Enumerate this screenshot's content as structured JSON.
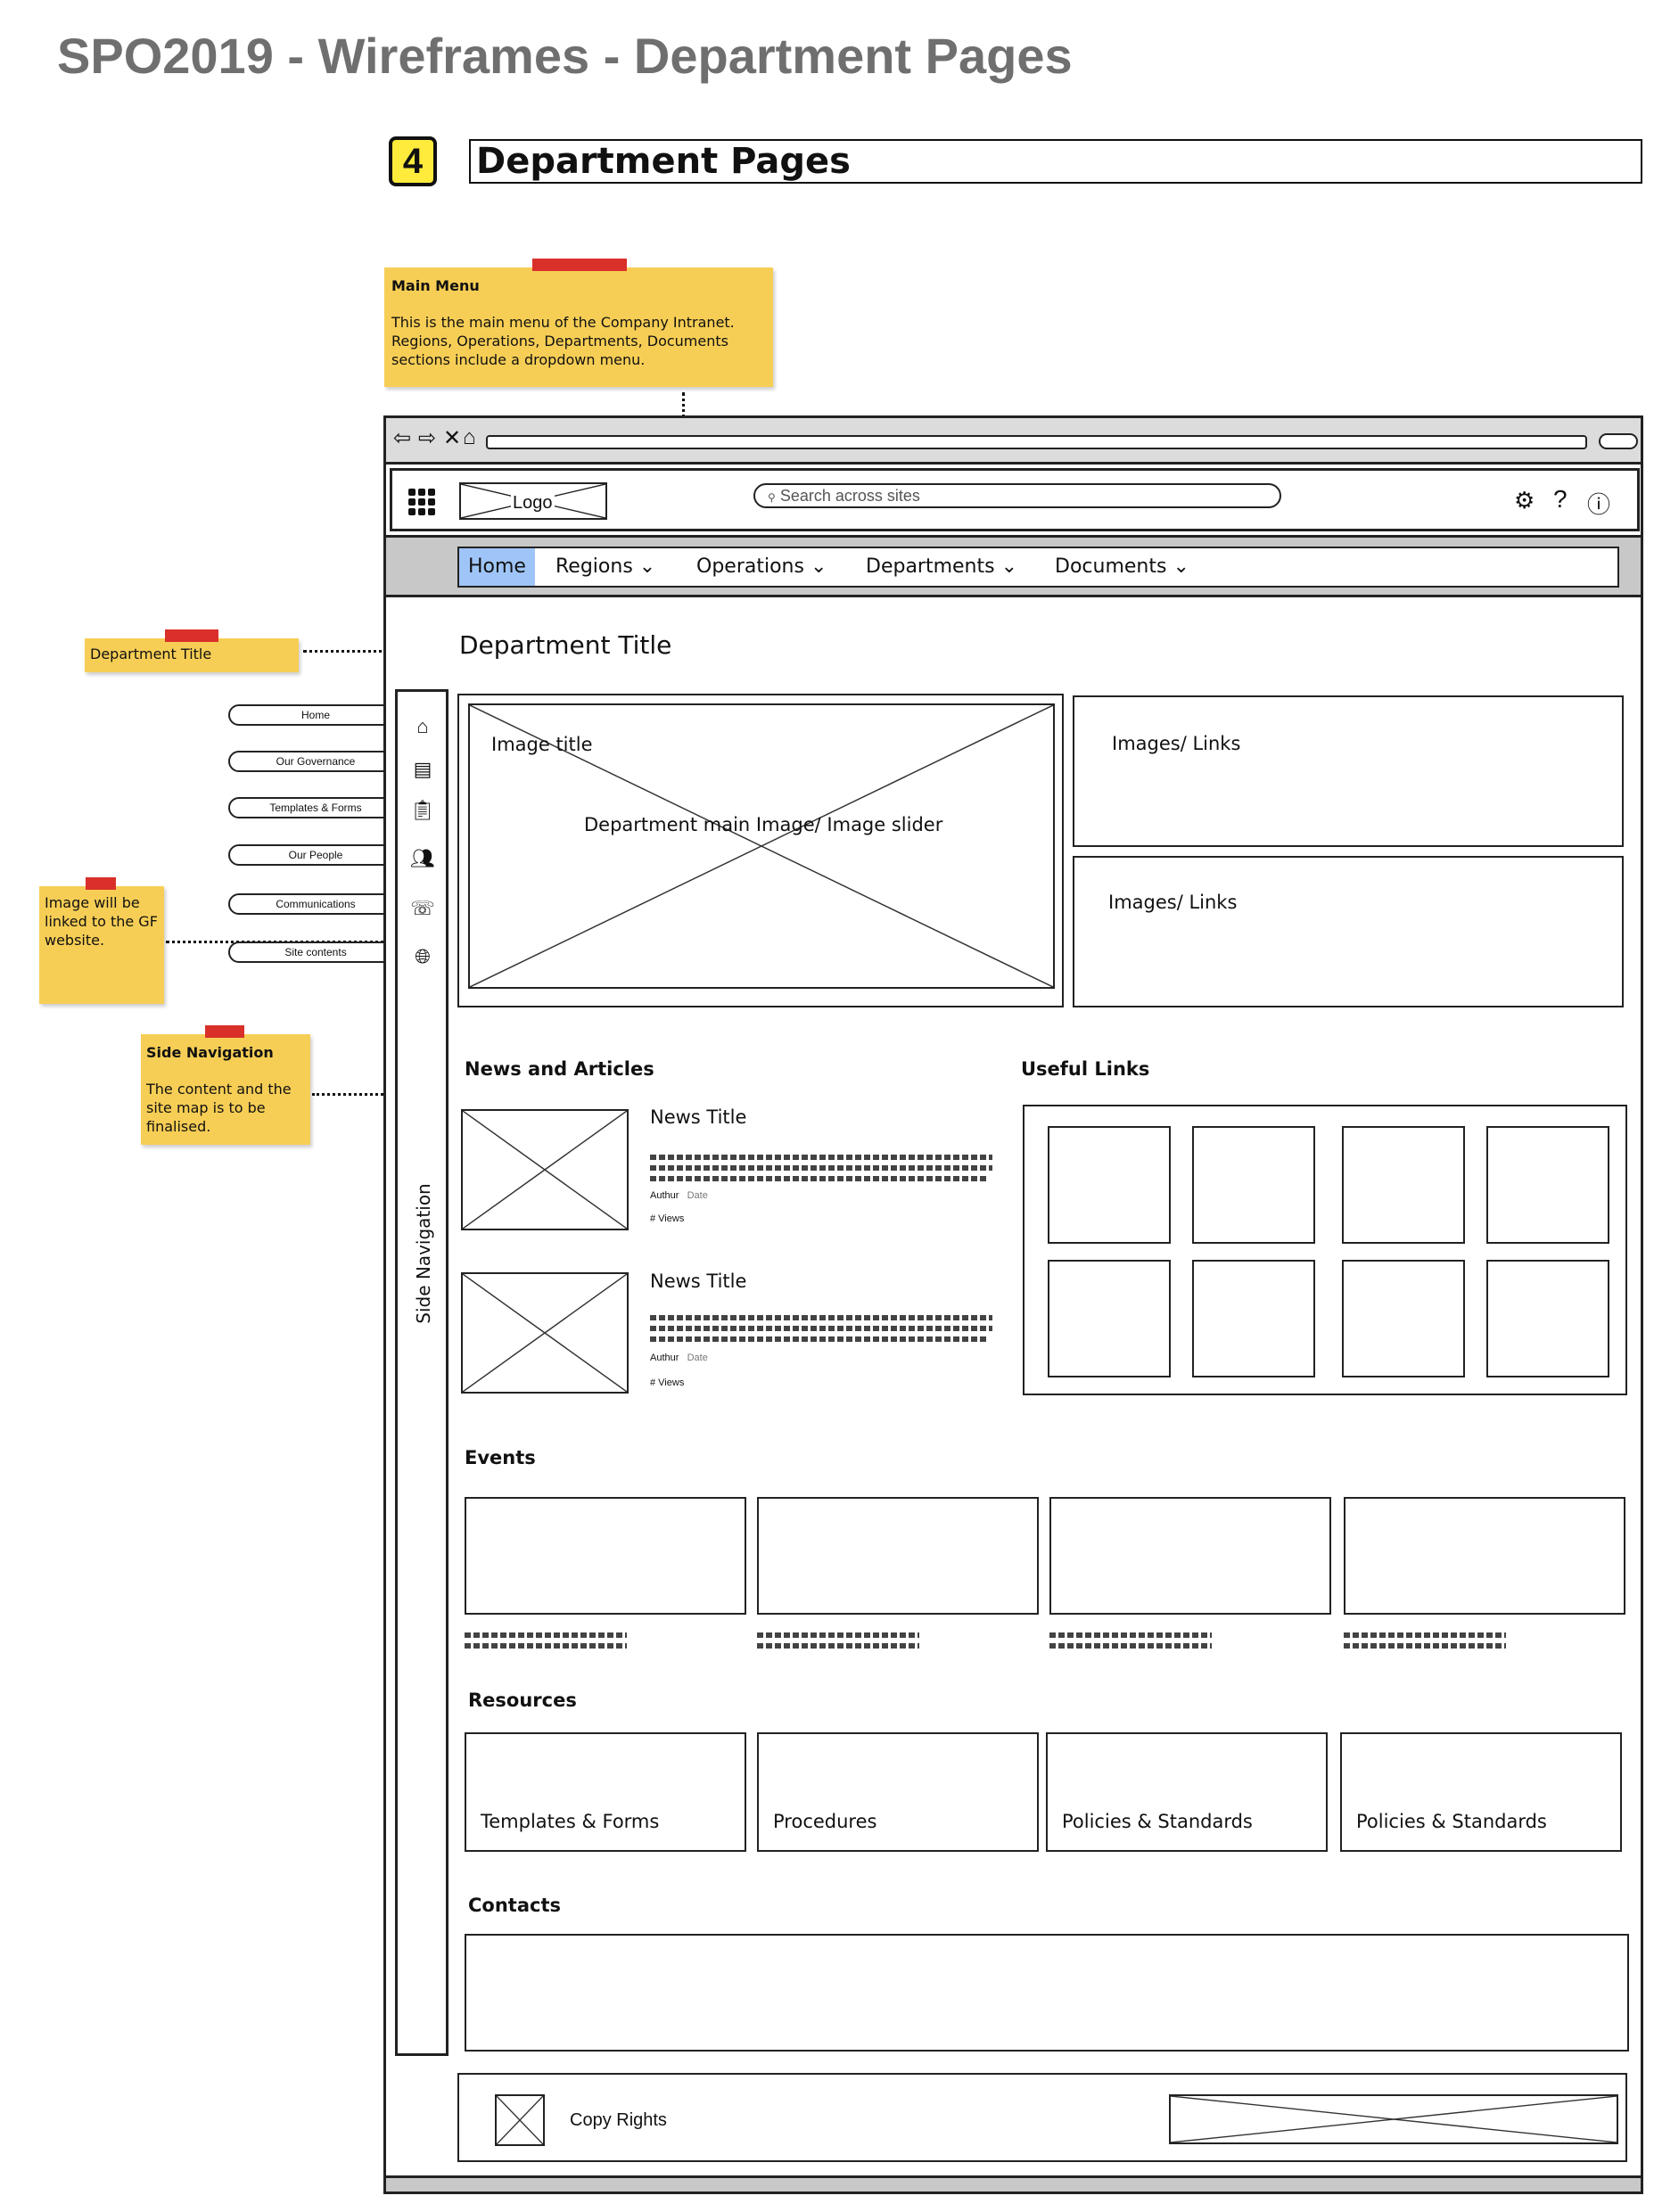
{
  "doc": {
    "title": "SPO2019 - Wireframes - Department Pages",
    "step": "4",
    "section": "Department Pages"
  },
  "notes": {
    "main_menu": {
      "title": "Main Menu",
      "body": "This is the main menu of the Company Intranet. Regions, Operations, Departments, Documents sections include a dropdown menu."
    },
    "dept_title": {
      "body": "Department Title"
    },
    "image_link": {
      "body": "Image will be linked to the GF website."
    },
    "side_nav": {
      "title": "Side Navigation",
      "body": "The content and the site map is to be finalised."
    }
  },
  "browser": {
    "nav_icons": [
      "arrow-left-icon",
      "arrow-right-icon",
      "close-icon",
      "home-icon"
    ],
    "logo": "Logo",
    "search_placeholder": "Search across sites",
    "utility_icons": [
      "gear-icon",
      "help-icon",
      "info-icon"
    ]
  },
  "menu": {
    "items": [
      {
        "label": "Home",
        "active": true
      },
      {
        "label": "Regions",
        "dropdown": true
      },
      {
        "label": "Operations",
        "dropdown": true
      },
      {
        "label": "Departments",
        "dropdown": true
      },
      {
        "label": "Documents",
        "dropdown": true
      }
    ]
  },
  "side_nav": {
    "label": "Side Navigation",
    "items": [
      {
        "label": "Home",
        "icon": "home-icon"
      },
      {
        "label": "Our Governance",
        "icon": "governance-icon"
      },
      {
        "label": "Templates & Forms",
        "icon": "clipboard-icon"
      },
      {
        "label": "Our People",
        "icon": "people-icon"
      },
      {
        "label": "Communications",
        "icon": "communications-icon"
      },
      {
        "label": "Site contents",
        "icon": "globe-icon"
      }
    ]
  },
  "page": {
    "title": "Department Title",
    "hero": {
      "image_title": "Image title",
      "caption": "Department main Image/ Image slider"
    },
    "side_links": [
      "Images/ Links",
      "Images/ Links"
    ],
    "news": {
      "heading": "News and Articles",
      "items": [
        {
          "title": "News Title",
          "author": "Authur",
          "date": "Date",
          "views": "# Views"
        },
        {
          "title": "News Title",
          "author": "Authur",
          "date": "Date",
          "views": "# Views"
        }
      ]
    },
    "useful_links": {
      "heading": "Useful Links",
      "count": 8
    },
    "events": {
      "heading": "Events",
      "count": 4
    },
    "resources": {
      "heading": "Resources",
      "items": [
        "Templates & Forms",
        "Procedures",
        "Policies & Standards",
        "Policies & Standards"
      ]
    },
    "contacts": {
      "heading": "Contacts"
    },
    "footer": {
      "copyright": "Copy Rights"
    }
  },
  "colors": {
    "sticky": "#f7ce55",
    "tape": "#d9302a",
    "active_menu": "#9fc5f8",
    "step_badge": "#ffeb3b",
    "doc_title": "#6f6f6f"
  }
}
